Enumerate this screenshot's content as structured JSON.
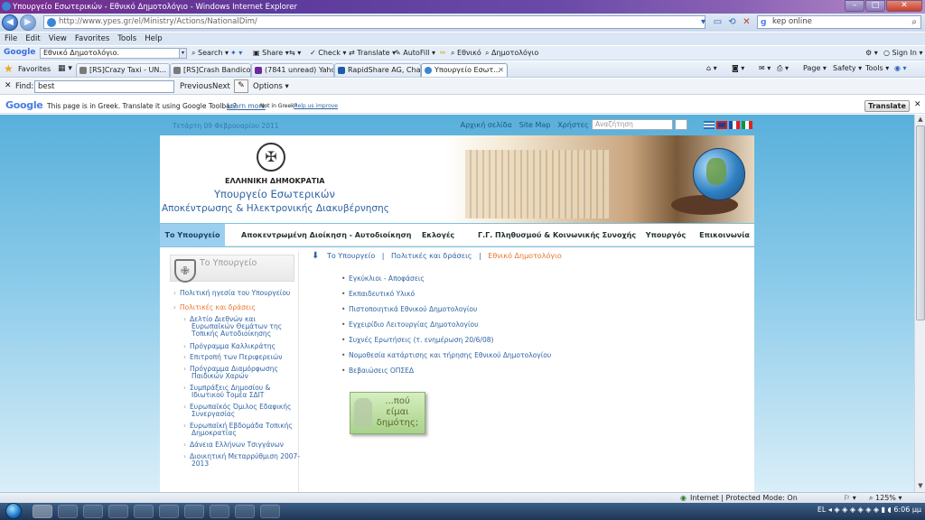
{
  "window": {
    "title": "Υπουργείο Εσωτερικών - Εθνικό Δημοτολόγιο - Windows Internet Explorer"
  },
  "address": {
    "url": "http://www.ypes.gr/el/Ministry/Actions/NationalDim/",
    "search_value": "kep online"
  },
  "menu": [
    "File",
    "Edit",
    "View",
    "Favorites",
    "Tools",
    "Help"
  ],
  "google_toolbar": {
    "logo": "Google",
    "search_value": "Εθνικό Δημοτολόγιο.",
    "items": [
      "Search",
      "Share",
      "Check",
      "Translate",
      "AutoFill",
      "Εθνικό",
      "Δημοτολόγιο"
    ],
    "sign_in": "Sign In"
  },
  "favorites": {
    "label": "Favorites",
    "tabs": [
      {
        "label": "[RS]Crazy Taxi - UN..."
      },
      {
        "label": "[RS]Crash Bandicoo..."
      },
      {
        "label": "(7841 unread) Yaho..."
      },
      {
        "label": "RapidShare AG, Cha..."
      },
      {
        "label": "Υπουργείο Εσωτ..."
      }
    ],
    "commands": [
      "Page",
      "Safety",
      "Tools"
    ]
  },
  "findbar": {
    "label": "Find:",
    "value": "best",
    "previous": "Previous",
    "next": "Next",
    "options": "Options"
  },
  "translate_bar": {
    "logo": "Google",
    "message": "This page is in Greek.  Translate it using Google Toolbar?",
    "learn_more": "Learn more",
    "not_greek": "Not in Greek?",
    "help": "Help us improve",
    "button": "Translate"
  },
  "site": {
    "date": "Τετάρτη 09 Φεβρουαρίου 2011",
    "top_links": [
      "Αρχική σελίδα",
      "Site Map",
      "Χρήστες"
    ],
    "search_placeholder": "Αναζήτηση",
    "go": "»",
    "header_line1": "ΕΛΛΗΝΙΚΗ ΔΗΜΟΚΡΑΤΙΑ",
    "header_line2": "Υπουργείο Εσωτερικών",
    "header_line3": "Αποκέντρωσης & Ηλεκτρονικής Διακυβέρνησης",
    "nav": [
      "Το Υπουργείο",
      "Αποκεντρωμένη Διοίκηση - Αυτοδιοίκηση",
      "Εκλογές",
      "Γ.Γ. Πληθυσμού & Κοινωνικής Συνοχής",
      "Υπουργός",
      "Επικοινωνία"
    ],
    "sidebar_title": "Το Υπουργείο",
    "sidebar": [
      {
        "label": "Πολιτική ηγεσία του Υπουργείου"
      },
      {
        "label": "Πολιτικές και δράσεις"
      },
      {
        "label": "Δελτίο Διεθνών και"
      },
      {
        "label": "Ευρωπαϊκών Θεμάτων της"
      },
      {
        "label": "Τοπικής Αυτοδιοίκησης"
      },
      {
        "label": "Πρόγραμμα Καλλικράτης"
      },
      {
        "label": "Επιτροπή των Περιφερειών"
      },
      {
        "label": "Πρόγραμμα Διαμόρφωσης"
      },
      {
        "label": "Παιδικών Χαρών"
      },
      {
        "label": "Συμπράξεις Δημοσίου &"
      },
      {
        "label": "Ιδιωτικού Τομέα ΣΔΙΤ"
      },
      {
        "label": "Ευρωπαϊκός Όμιλος Εδαφικής"
      },
      {
        "label": "Συνεργασίας"
      },
      {
        "label": "Ευρωπαϊκή Εβδομάδα Τοπικής"
      },
      {
        "label": "Δημοκρατίας"
      },
      {
        "label": "Δάνεια Ελλήνων Τσιγγάνων"
      },
      {
        "label": "Διοικητική Μεταρρύθμιση 2007-"
      },
      {
        "label": "2013"
      }
    ],
    "breadcrumb": [
      "Το Υπουργείο",
      "Πολιτικές και δράσεις",
      "Εθνικό Δημοτολόγιο"
    ],
    "links": [
      "Εγκύκλιοι - Αποφάσεις",
      "Εκπαιδευτικό Υλικό",
      "Πιστοποιητικά Εθνικού Δημοτολογίου",
      "Εγχειρίδιο Λειτουργίας Δημοτολογίου",
      "Συχνές Ερωτήσεις (τ. ενημέρωση 20/6/08)",
      "Νομοθεσία κατάρτισης και τήρησης Εθνικού Δημοτολογίου",
      "Βεβαιώσεις ΟΠΣΕΔ"
    ],
    "badge": [
      "...πού",
      "είμαι",
      "δημότης;"
    ]
  },
  "status": {
    "zone": "Internet | Protected Mode: On",
    "zoom": "125%"
  },
  "taskbar": {
    "lang": "EL",
    "time": "6:06 μμ"
  },
  "colors": {
    "link": "#2f63a3",
    "highlight": "#e8762a",
    "nav_active": "#9bcff0",
    "page_bg": "#58b0db"
  }
}
